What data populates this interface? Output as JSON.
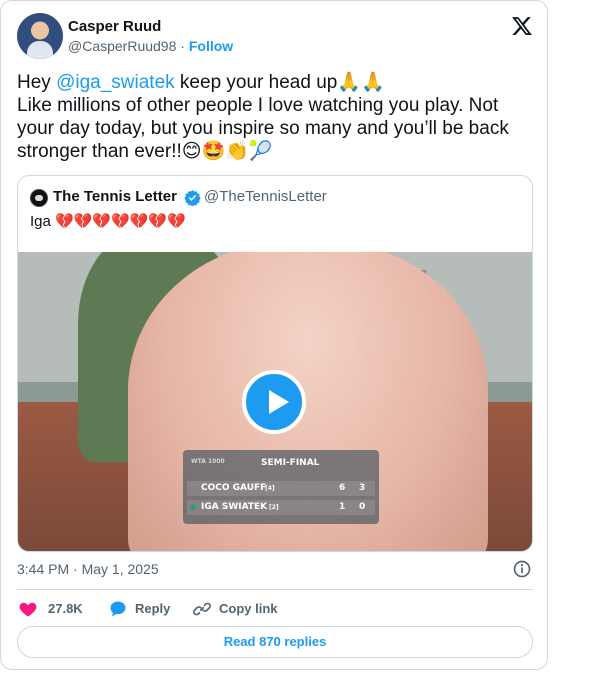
{
  "author": {
    "name": "Casper Ruud",
    "handle": "@CasperRuud98",
    "separator": "·",
    "follow_label": "Follow"
  },
  "tweet": {
    "line1_prefix": "Hey ",
    "mention": "@iga_swiatek",
    "line1_suffix": " keep your head up🙏🙏",
    "line2": "Like millions of other people I love watching you play. Not your day today, but you inspire so many and you’ll be back stronger than ever!!😊🤩👏🎾"
  },
  "quoted": {
    "name": "The Tennis Letter",
    "handle": "@TheTennisLetter",
    "text": "Iga 💔💔💔💔💔💔💔",
    "media": {
      "scoreboard": {
        "brand": "WTA 1000",
        "title": "SEMI-FINAL",
        "players": [
          {
            "name": "COCO GAUFF",
            "seed": "[4]",
            "set1": "6",
            "set2": "3"
          },
          {
            "name": "IGA SWIATEK",
            "seed": "[2]",
            "set1": "1",
            "set2": "0"
          }
        ]
      }
    }
  },
  "timestamp": "3:44 PM · May 1, 2025",
  "actions": {
    "likes": "27.8K",
    "reply_label": "Reply",
    "copy_label": "Copy link"
  },
  "read_replies_label": "Read 870 replies",
  "colors": {
    "accent": "#1d9bf0",
    "like": "#f91880",
    "text": "#0f1419",
    "muted": "#536471",
    "border": "#cfd9de"
  }
}
